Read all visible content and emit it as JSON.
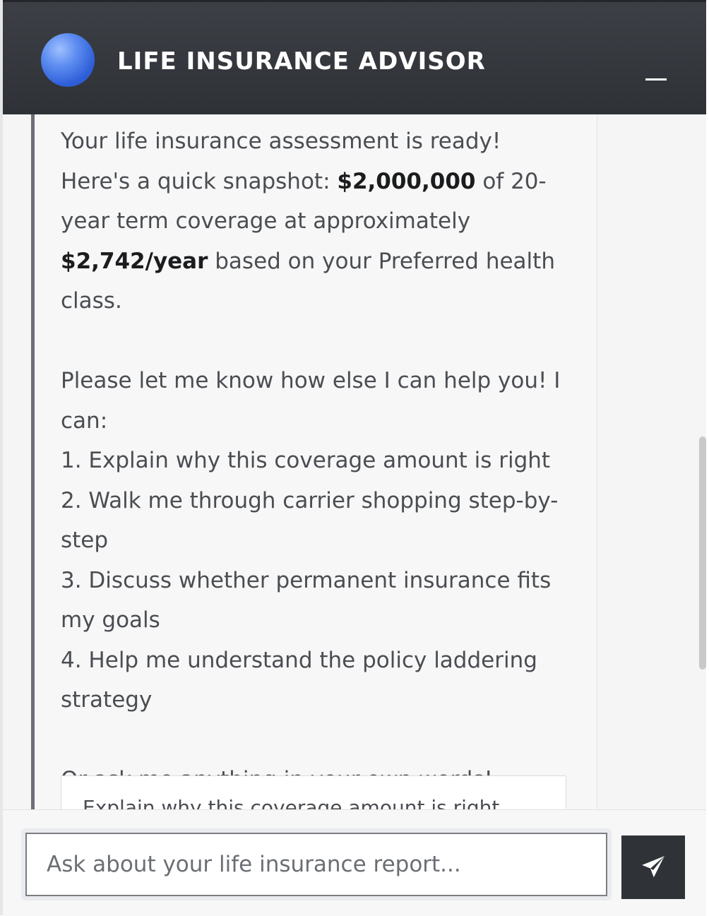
{
  "header": {
    "title": "LIFE INSURANCE ADVISOR",
    "minimize_label": "_"
  },
  "message": {
    "intro_1": "Your life insurance assessment is ready! Here's a quick snapshot: ",
    "coverage_amount": "$2,000,000",
    "intro_2": " of 20-year term coverage at approximately ",
    "annual_cost": "$2,742/year",
    "intro_3": " based on your Preferred health class.",
    "help_prompt": "Please let me know how else I can help you! I can:",
    "options": [
      "1. Explain why this coverage amount is right",
      "2. Walk me through carrier shopping step-by-step",
      "3. Discuss whether permanent insurance fits my goals",
      "4. Help me understand the policy laddering strategy"
    ],
    "closing": "Or ask me anything in your own words!"
  },
  "suggestions": [
    "Explain why this coverage amount is right"
  ],
  "input": {
    "placeholder": "Ask about your life insurance report..."
  },
  "icons": {
    "avatar": "blue-sphere-avatar",
    "send": "paper-plane-icon",
    "minimize": "minimize-icon"
  },
  "colors": {
    "header_bg": "#2e3136",
    "accent_border": "#6c7078",
    "send_button": "#2f3237",
    "avatar": "#4a78e8"
  }
}
